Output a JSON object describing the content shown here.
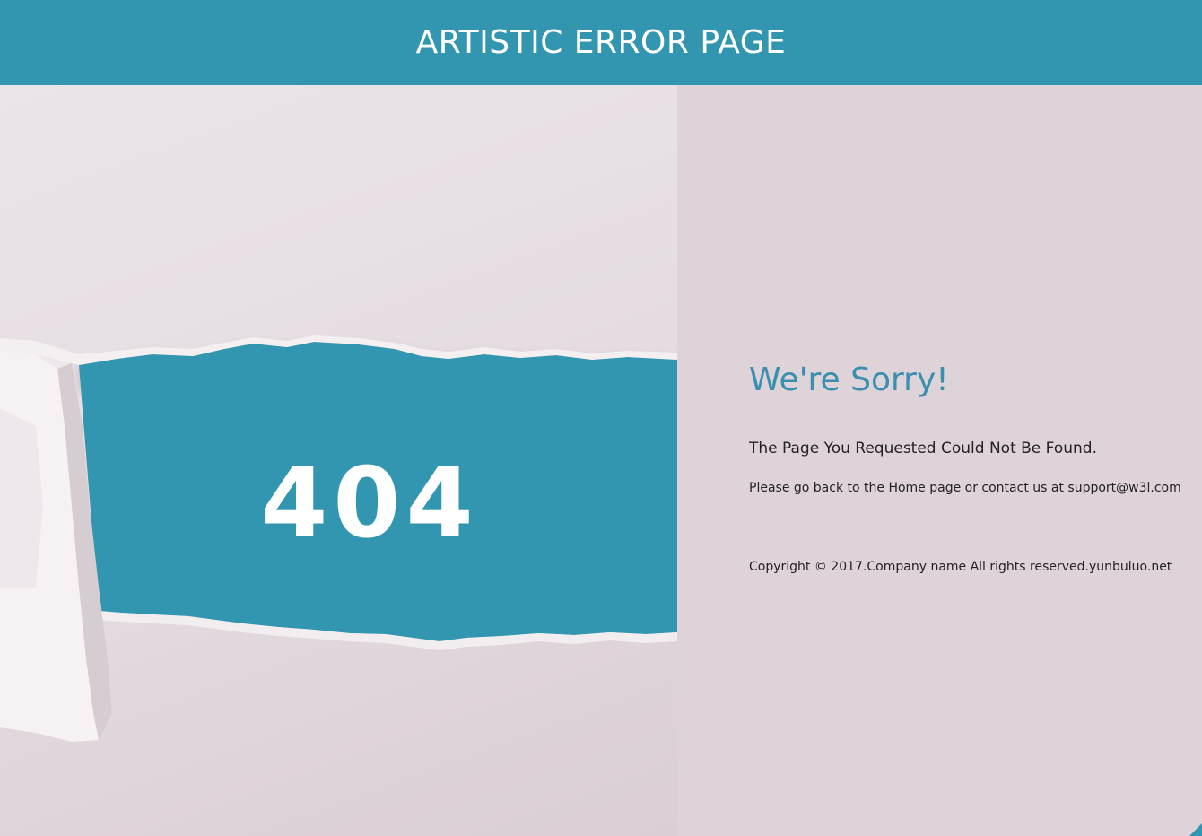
{
  "header": {
    "title": "ARTISTIC ERROR PAGE"
  },
  "art": {
    "error_code": "404",
    "colors": {
      "teal": "#3396b1",
      "paper": "#e6dfe3"
    }
  },
  "message": {
    "heading": "We're Sorry!",
    "subheading": "The Page You Requested Could Not Be Found.",
    "go_back_prefix": "Please go back to the ",
    "home_link": "Home",
    "go_back_middle": " page or contact us at ",
    "email_link": "support@w3l.com"
  },
  "footer": {
    "copyright": "Copyright © 2017.Company name All rights reserved.yunbuluo.net"
  },
  "colors": {
    "header_bg": "#3396b1",
    "page_bg": "#ded3d9",
    "heading": "#3b8fae",
    "text": "#222222"
  }
}
